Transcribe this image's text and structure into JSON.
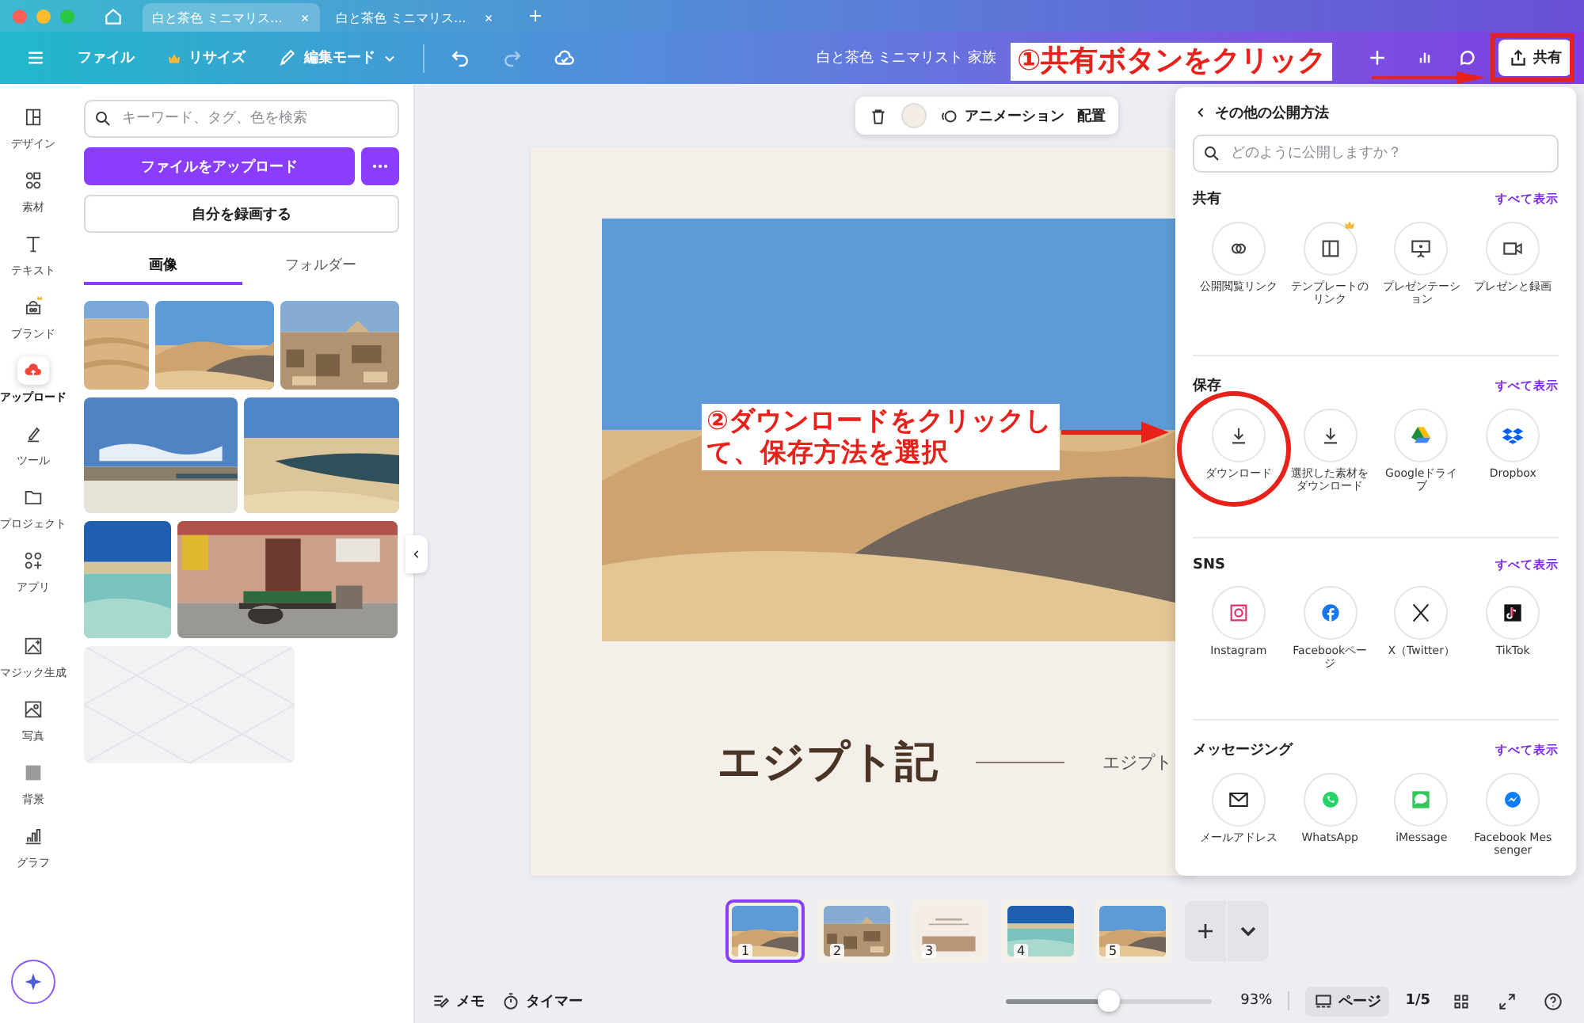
{
  "browser": {
    "tabs": [
      {
        "title": "白と茶色 ミニマリス...",
        "selected": true
      },
      {
        "title": "白と茶色 ミニマリス...",
        "selected": false
      }
    ]
  },
  "toolbar": {
    "file": "ファイル",
    "resize": "リサイズ",
    "edit_mode": "編集モード",
    "title": "白と茶色 ミニマリスト 家族",
    "share": "共有"
  },
  "rail": [
    {
      "label": "デザイン",
      "selected": false
    },
    {
      "label": "素材",
      "selected": false
    },
    {
      "label": "テキスト",
      "selected": false
    },
    {
      "label": "ブランド",
      "selected": false
    },
    {
      "label": "アップロード",
      "selected": true
    },
    {
      "label": "ツール",
      "selected": false
    },
    {
      "label": "プロジェクト",
      "selected": false
    },
    {
      "label": "アプリ",
      "selected": false
    },
    {
      "label": "マジック生成",
      "selected": false
    },
    {
      "label": "写真",
      "selected": false
    },
    {
      "label": "背景",
      "selected": false
    },
    {
      "label": "グラフ",
      "selected": false
    }
  ],
  "panel": {
    "search_placeholder": "キーワード、タグ、色を検索",
    "upload": "ファイルをアップロード",
    "record": "自分を録画する",
    "tabs": [
      {
        "label": "画像",
        "selected": true
      },
      {
        "label": "フォルダー",
        "selected": false
      }
    ]
  },
  "canvas": {
    "animation": "アニメーション",
    "arrange": "配置",
    "title": "エジプト記",
    "subtitle": "エジプト"
  },
  "share_panel": {
    "back": "その他の公開方法",
    "search_placeholder": "どのように公開しますか？",
    "sections": [
      {
        "title": "共有",
        "see_all": "すべて表示",
        "items": [
          {
            "label": "公開閲覧リンク"
          },
          {
            "label": "テンプレートのリンク"
          },
          {
            "label": "プレゼンテーション"
          },
          {
            "label": "プレゼンと録画"
          }
        ]
      },
      {
        "title": "保存",
        "see_all": "すべて表示",
        "items": [
          {
            "label": "ダウンロード"
          },
          {
            "label": "選択した素材をダウンロード"
          },
          {
            "label": "Googleドライブ"
          },
          {
            "label": "Dropbox"
          }
        ]
      },
      {
        "title": "SNS",
        "see_all": "すべて表示",
        "items": [
          {
            "label": "Instagram"
          },
          {
            "label": "Facebookページ"
          },
          {
            "label": "X（Twitter）"
          },
          {
            "label": "TikTok"
          }
        ]
      },
      {
        "title": "メッセージング",
        "see_all": "すべて表示",
        "items": [
          {
            "label": "メールアドレス"
          },
          {
            "label": "WhatsApp"
          },
          {
            "label": "iMessage"
          },
          {
            "label": "Facebook Messenger"
          }
        ]
      }
    ]
  },
  "pages": [
    {
      "number": "1",
      "selected": true
    },
    {
      "number": "2",
      "selected": false
    },
    {
      "number": "3",
      "selected": false
    },
    {
      "number": "4",
      "selected": false
    },
    {
      "number": "5",
      "selected": false
    }
  ],
  "footer": {
    "memo": "メモ",
    "timer": "タイマー",
    "zoom": {
      "level": 0.5,
      "reading": "93%"
    },
    "page_view": "ページ",
    "page_count": "1/5"
  },
  "annotations": [
    {
      "text": "①共有ボタンをクリック"
    },
    {
      "text": "②ダウンロードをクリックして、保存方法を選択"
    }
  ]
}
